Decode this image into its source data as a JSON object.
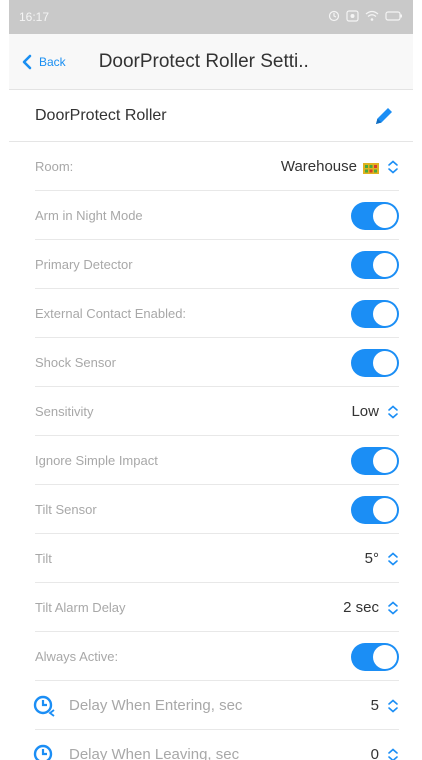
{
  "status_bar": {
    "time": "16:17"
  },
  "nav": {
    "back_label": "Back",
    "title": "DoorProtect Roller Setti.."
  },
  "device": {
    "name": "DoorProtect Roller"
  },
  "colors": {
    "accent": "#1b8ef5",
    "label": "#a8a8a8"
  },
  "settings": {
    "room": {
      "label": "Room:",
      "value": "Warehouse"
    },
    "arm_night": {
      "label": "Arm in Night Mode",
      "on": true
    },
    "primary_detector": {
      "label": "Primary Detector",
      "on": true
    },
    "external_contact": {
      "label": "External Contact Enabled:",
      "on": true
    },
    "shock_sensor": {
      "label": "Shock Sensor",
      "on": true
    },
    "sensitivity": {
      "label": "Sensitivity",
      "value": "Low"
    },
    "ignore_simple_impact": {
      "label": "Ignore Simple Impact",
      "on": true
    },
    "tilt_sensor": {
      "label": "Tilt Sensor",
      "on": true
    },
    "tilt": {
      "label": "Tilt",
      "value": "5°"
    },
    "tilt_alarm_delay": {
      "label": "Tilt Alarm Delay",
      "value": "2 sec"
    },
    "always_active": {
      "label": "Always Active:",
      "on": true
    },
    "delay_entering": {
      "label": "Delay When Entering, sec",
      "value": "5"
    },
    "delay_leaving": {
      "label": "Delay When Leaving, sec",
      "value": "0"
    }
  }
}
